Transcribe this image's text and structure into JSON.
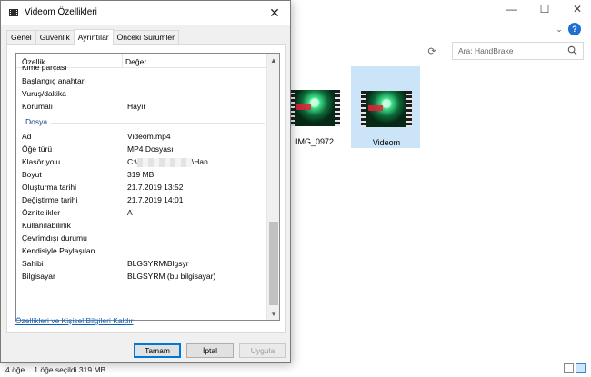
{
  "explorer": {
    "search_placeholder": "Ara: HandBrake",
    "window_controls": {
      "minimize": "—",
      "maximize": "☐",
      "close": "✕"
    },
    "help": "?",
    "files": [
      {
        "label": "IMG_0972",
        "selected": false
      },
      {
        "label": "Videom",
        "selected": true
      }
    ],
    "status": {
      "count": "4 öğe",
      "selection": "1 öğe seçildi  319 MB"
    }
  },
  "dialog": {
    "title": "Videom Özellikleri",
    "close": "✕",
    "tabs": [
      {
        "label": "Genel",
        "active": false
      },
      {
        "label": "Güvenlik",
        "active": false
      },
      {
        "label": "Ayrıntılar",
        "active": true
      },
      {
        "label": "Önceki Sürümler",
        "active": false
      }
    ],
    "list": {
      "col_property": "Özellik",
      "col_value": "Değer",
      "rows_top": [
        {
          "key": "Kime parçası",
          "value": ""
        },
        {
          "key": "Başlangıç anahtarı",
          "value": ""
        },
        {
          "key": "Vuruş/dakika",
          "value": ""
        },
        {
          "key": "Korumalı",
          "value": "Hayır"
        }
      ],
      "group_label": "Dosya",
      "rows_file": [
        {
          "key": "Ad",
          "value": "Videom.mp4"
        },
        {
          "key": "Öğe türü",
          "value": "MP4 Dosyası"
        },
        {
          "key": "Klasör yolu",
          "value_prefix": "C:\\",
          "value_suffix": "\\Han..."
        },
        {
          "key": "Boyut",
          "value": "319 MB"
        },
        {
          "key": "Oluşturma tarihi",
          "value": "21.7.2019 13:52"
        },
        {
          "key": "Değiştirme tarihi",
          "value": "21.7.2019 14:01"
        },
        {
          "key": "Öznitelikler",
          "value": "A"
        },
        {
          "key": "Kullanılabilirlik",
          "value": ""
        },
        {
          "key": "Çevrimdışı durumu",
          "value": ""
        },
        {
          "key": "Kendisiyle Paylaşılan",
          "value": ""
        },
        {
          "key": "Sahibi",
          "value": "BLGSYRM\\Blgsyr"
        },
        {
          "key": "Bilgisayar",
          "value": "BLGSYRM (bu bilgisayar)"
        }
      ]
    },
    "remove_link": "Özellikleri ve Kişisel Bilgileri Kaldır",
    "buttons": {
      "ok": "Tamam",
      "cancel": "İptal",
      "apply": "Uygula"
    }
  }
}
